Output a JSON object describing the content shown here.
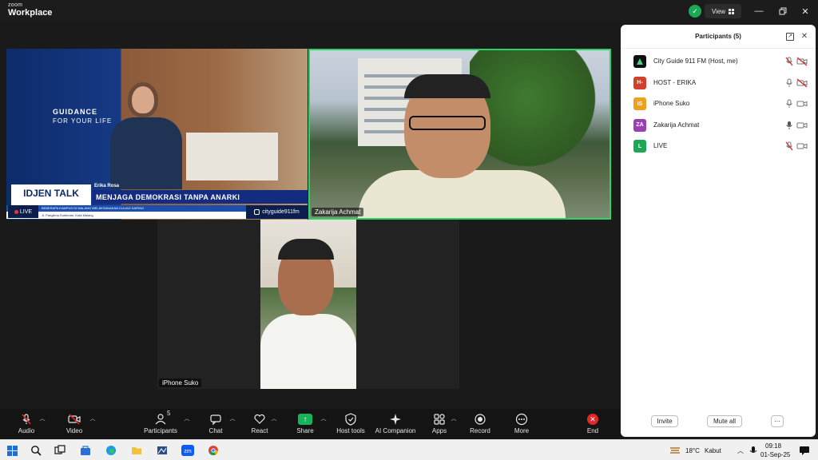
{
  "window": {
    "brand_top": "zoom",
    "brand_bottom": "Workplace",
    "view_label": "View",
    "colors": {
      "accent_green": "#2bd365",
      "share_green": "#19b45a",
      "end_red": "#e02828"
    }
  },
  "tiles": {
    "studio": {
      "guidance_line1": "GUIDANCE",
      "guidance_line2": "FOR YOUR LIFE",
      "logo": "IDJEN TALK",
      "anchor_name": "Erika Rosa",
      "headline": "MENJAGA DEMOKRASI TANPA ANARKI",
      "live_label": "LIVE",
      "handle": "cityguide911fm",
      "ticker": "BEBERAPA KAMPUS DI MALANG MELAKSANAKAN KULIAH DARING",
      "address": "Jl. Panglima Sudirman, Kota Malang"
    },
    "speaker": {
      "name": "Zakarija Achmat"
    },
    "iphone": {
      "name": "iPhone Suko"
    }
  },
  "toolbar": {
    "audio": "Audio",
    "video": "Video",
    "participants": "Participants",
    "participants_count": "5",
    "chat": "Chat",
    "react": "React",
    "share": "Share",
    "host_tools": "Host tools",
    "ai_companion": "AI Companion",
    "apps": "Apps",
    "record": "Record",
    "more": "More",
    "end": "End"
  },
  "panel": {
    "title": "Participants (5)",
    "participants": [
      {
        "initials": "",
        "name": "City Guide 911 FM (Host, me)",
        "color": "#111111",
        "mic": "muted",
        "cam": "off"
      },
      {
        "initials": "H-",
        "name": "HOST - ERIKA",
        "color": "#d0402a",
        "mic": "on",
        "cam": "off"
      },
      {
        "initials": "IS",
        "name": "iPhone Suko",
        "color": "#f0a020",
        "mic": "on",
        "cam": "on"
      },
      {
        "initials": "ZA",
        "name": "Zakarija Achmat",
        "color": "#9b3fb5",
        "mic": "speaking",
        "cam": "on"
      },
      {
        "initials": "L",
        "name": "LIVE",
        "color": "#1ea855",
        "mic": "muted",
        "cam": "on"
      }
    ],
    "invite": "Invite",
    "mute_all": "Mute all",
    "more": "···"
  },
  "taskbar": {
    "temperature": "18°C",
    "weather": "Kabut",
    "time": "09:18",
    "date": "01-Sep-25"
  }
}
